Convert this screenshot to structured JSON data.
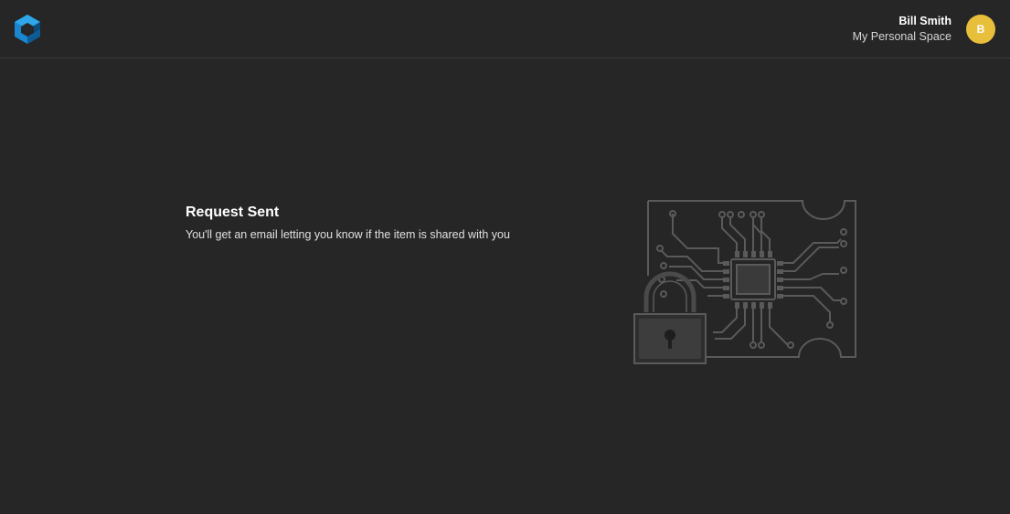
{
  "header": {
    "logo_icon": "cube-logo-icon",
    "user": {
      "name": "Bill Smith",
      "space": "My Personal Space",
      "avatar_initial": "B",
      "avatar_color": "#e8bf3b"
    }
  },
  "main": {
    "title": "Request Sent",
    "message": "You'll get an email letting you know if the item is shared with you",
    "illustration_icon": "circuit-lock-illustration"
  },
  "colors": {
    "background": "#262626",
    "illustration_stroke": "#5a5a5a",
    "logo_blue": "#1e8fd6"
  }
}
